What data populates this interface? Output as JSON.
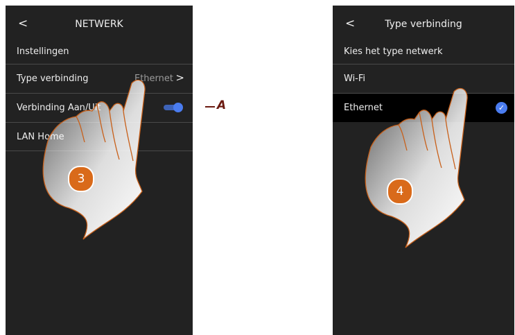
{
  "left_screen": {
    "back_glyph": "<",
    "title": "NETWERK",
    "section_label": "Instellingen",
    "rows": [
      {
        "label": "Type verbinding",
        "value": "Ethernet",
        "chevron": ">"
      },
      {
        "label": "Verbinding Aan/Uit",
        "toggle_on": true
      },
      {
        "label": "LAN Home"
      }
    ],
    "step_number": "3"
  },
  "right_screen": {
    "back_glyph": "<",
    "title": "Type verbinding",
    "section_label": "Kies het type netwerk",
    "rows": [
      {
        "label": "Wi-Fi",
        "selected": false
      },
      {
        "label": "Ethernet",
        "selected": true,
        "check": "✓"
      }
    ],
    "step_number": "4"
  },
  "callout": {
    "label": "A"
  },
  "colors": {
    "accent": "#4a7cf0",
    "screen_bg": "#222222",
    "step_badge": "#d96a1a",
    "callout": "#6b1a10"
  }
}
